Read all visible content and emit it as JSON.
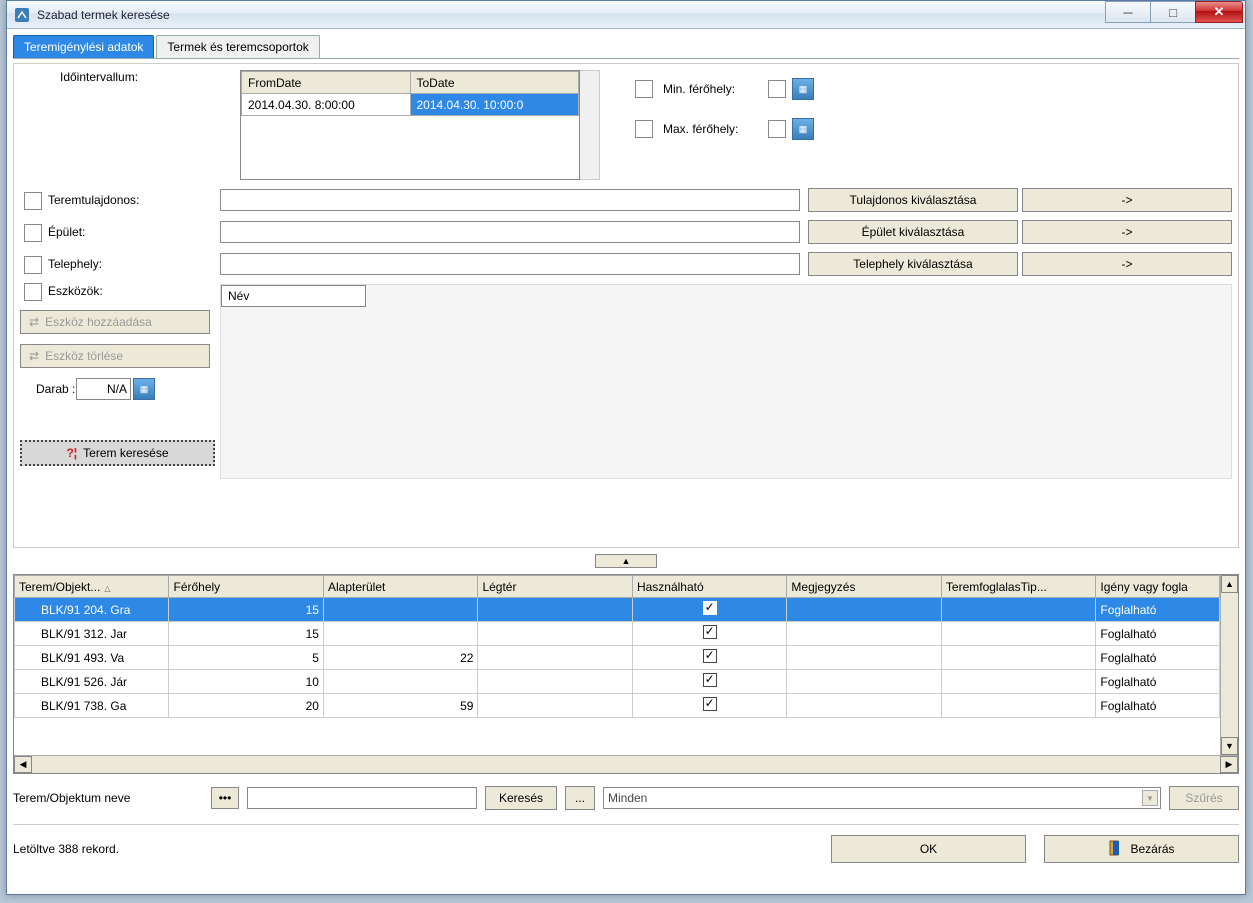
{
  "window": {
    "title": "Szabad termek keresése"
  },
  "tabs": {
    "active": "Teremigénylési adatok",
    "inactive": "Termek és teremcsoportok"
  },
  "labels": {
    "interval": "Időintervallum:",
    "fromdate_header": "FromDate",
    "todate_header": "ToDate",
    "minferohely": "Min. férőhely:",
    "maxferohely": "Max. férőhely:",
    "teremtulajdonos": "Teremtulajdonos:",
    "epulet": "Épület:",
    "telephely": "Telephely:",
    "eszkozok": "Eszközök:",
    "nev": "Név",
    "darab": "Darab :",
    "darab_val": "N/A",
    "terem_objektum_neve": "Terem/Objektum neve"
  },
  "interval": {
    "from": "2014.04.30. 8:00:00",
    "to": "2014.04.30. 10:00:0"
  },
  "buttons": {
    "tulajdonos": "Tulajdonos kiválasztása",
    "epulet": "Épület kiválasztása",
    "telephely": "Telephely kiválasztása",
    "arrow": "->",
    "eszkoz_hozzad": "Eszköz hozzáadása",
    "eszkoz_torles": "Eszköz törlése",
    "terem_keresese": "Terem keresése",
    "kereses": "Keresés",
    "dots": "...",
    "szures": "Szűrés",
    "ok": "OK",
    "bezaras": "Bezárás"
  },
  "filter": {
    "dropdown": "Minden"
  },
  "columns": {
    "terem": "Terem/Objekt...",
    "ferohely": "Férőhely",
    "alapterulet": "Alapterület",
    "legter": "Légtér",
    "hasznalhato": "Használható",
    "megjegyzes": "Megjegyzés",
    "teremfoglalas": "TeremfoglalasTip...",
    "igeny": "Igény vagy fogla"
  },
  "rows": [
    {
      "terem": "BLK/91 204. Gra",
      "ferohely": "15",
      "alapterulet": "",
      "hasznalhato": true,
      "igeny": "Foglalható",
      "sel": true
    },
    {
      "terem": "BLK/91 312. Jar",
      "ferohely": "15",
      "alapterulet": "",
      "hasznalhato": true,
      "igeny": "Foglalható"
    },
    {
      "terem": "BLK/91 493. Va",
      "ferohely": "5",
      "alapterulet": "22",
      "hasznalhato": true,
      "igeny": "Foglalható"
    },
    {
      "terem": "BLK/91 526. Jár",
      "ferohely": "10",
      "alapterulet": "",
      "hasznalhato": true,
      "igeny": "Foglalható"
    },
    {
      "terem": "BLK/91 738. Ga",
      "ferohely": "20",
      "alapterulet": "59",
      "hasznalhato": true,
      "igeny": "Foglalható"
    }
  ],
  "status": "Letöltve 388 rekord."
}
